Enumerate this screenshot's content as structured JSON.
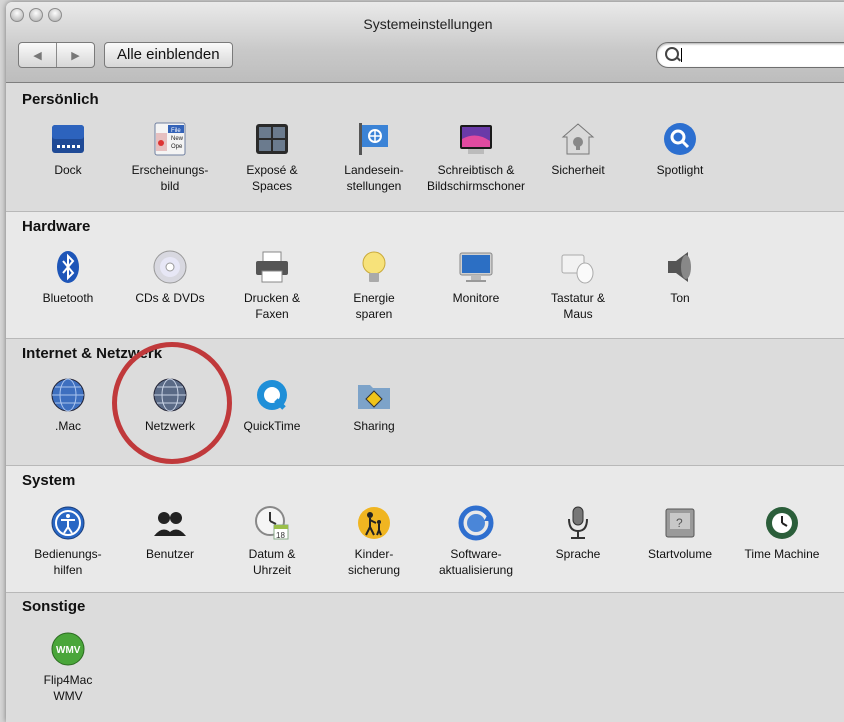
{
  "window": {
    "title": "Systemeinstellungen"
  },
  "toolbar": {
    "back_icon": "◀",
    "forward_icon": "▶",
    "show_all_label": "Alle einblenden",
    "search_value": ""
  },
  "sections": [
    {
      "title": "Persönlich",
      "items": [
        {
          "label": "Dock",
          "icon": "dock-icon"
        },
        {
          "label": "Erscheinungs-\nbild",
          "icon": "appearance-icon",
          "icon_text": [
            "File",
            "New",
            "Ope"
          ]
        },
        {
          "label": "Exposé &\nSpaces",
          "icon": "expose-spaces-icon"
        },
        {
          "label": "Landesein-\nstellungen",
          "icon": "international-flag-icon"
        },
        {
          "label": "Schreibtisch &\nBildschirmschoner",
          "icon": "desktop-screensaver-icon"
        },
        {
          "label": "Sicherheit",
          "icon": "security-house-icon"
        },
        {
          "label": "Spotlight",
          "icon": "spotlight-icon"
        }
      ]
    },
    {
      "title": "Hardware",
      "items": [
        {
          "label": "Bluetooth",
          "icon": "bluetooth-icon"
        },
        {
          "label": "CDs & DVDs",
          "icon": "cd-dvd-icon"
        },
        {
          "label": "Drucken &\nFaxen",
          "icon": "printer-icon"
        },
        {
          "label": "Energie\nsparen",
          "icon": "light-bulb-icon"
        },
        {
          "label": "Monitore",
          "icon": "monitor-icon"
        },
        {
          "label": "Tastatur &\nMaus",
          "icon": "keyboard-mouse-icon"
        },
        {
          "label": "Ton",
          "icon": "speaker-icon"
        }
      ]
    },
    {
      "title": "Internet & Netzwerk",
      "items": [
        {
          "label": ".Mac",
          "icon": "dotmac-globe-icon"
        },
        {
          "label": "Netzwerk",
          "icon": "network-globe-icon"
        },
        {
          "label": "QuickTime",
          "icon": "quicktime-icon"
        },
        {
          "label": "Sharing",
          "icon": "sharing-folder-icon"
        }
      ]
    },
    {
      "title": "System",
      "items": [
        {
          "label": "Bedienungs-\nhilfen",
          "icon": "accessibility-icon"
        },
        {
          "label": "Benutzer",
          "icon": "accounts-icon"
        },
        {
          "label": "Datum &\nUhrzeit",
          "icon": "date-time-icon",
          "icon_text": [
            "18"
          ]
        },
        {
          "label": "Kinder-\nsicherung",
          "icon": "parental-controls-icon"
        },
        {
          "label": "Software-\naktualisierung",
          "icon": "software-update-icon"
        },
        {
          "label": "Sprache",
          "icon": "microphone-icon"
        },
        {
          "label": "Startvolume",
          "icon": "startup-disk-icon",
          "icon_text": [
            "?"
          ]
        },
        {
          "label": "Time Machine",
          "icon": "time-machine-icon"
        }
      ]
    },
    {
      "title": "Sonstige",
      "items": [
        {
          "label": "Flip4Mac\nWMV",
          "icon": "flip4mac-wmv-icon",
          "icon_text": [
            "WMV"
          ]
        }
      ]
    }
  ]
}
